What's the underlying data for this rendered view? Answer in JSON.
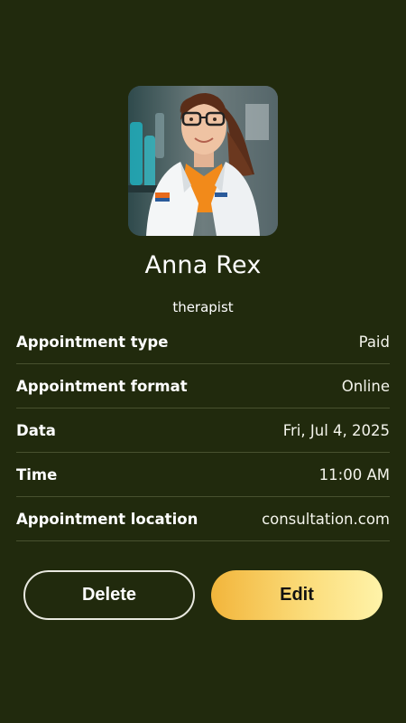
{
  "profile": {
    "name": "Anna Rex",
    "role": "therapist"
  },
  "details": [
    {
      "label": "Appointment type",
      "value": "Paid"
    },
    {
      "label": "Appointment format",
      "value": "Online"
    },
    {
      "label": "Data",
      "value": "Fri, Jul 4, 2025"
    },
    {
      "label": "Time",
      "value": "11:00 AM"
    },
    {
      "label": "Appointment location",
      "value": "consultation.com"
    }
  ],
  "actions": {
    "delete_label": "Delete",
    "edit_label": "Edit"
  },
  "colors": {
    "background": "#212a0d",
    "divider": "#48512f",
    "edit_gradient_start": "#f2b53b",
    "edit_gradient_end": "#fff3a9"
  }
}
